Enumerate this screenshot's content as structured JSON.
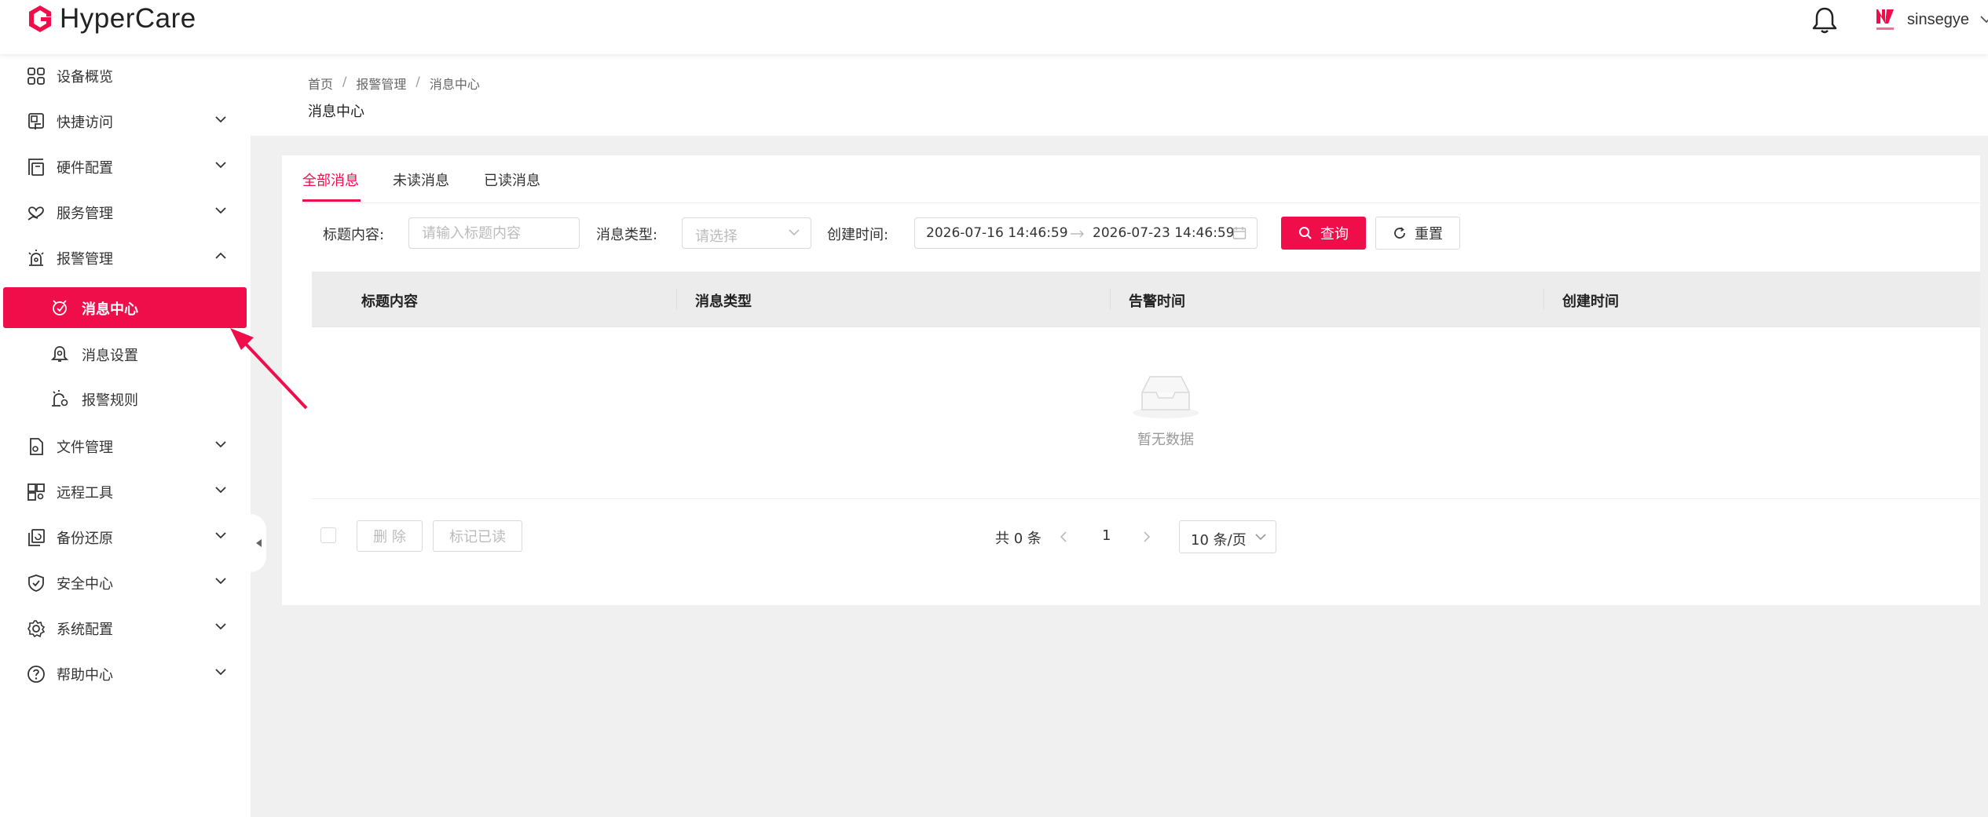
{
  "header": {
    "app_name": "HyperCare",
    "user_name": "sinsegye",
    "colors": {
      "brand": "#ef0e4a"
    }
  },
  "sidebar": {
    "items": [
      {
        "label": "设备概览",
        "icon": "grid-icon"
      },
      {
        "label": "快捷访问",
        "icon": "quick-access-icon"
      },
      {
        "label": "硬件配置",
        "icon": "hardware-icon"
      },
      {
        "label": "服务管理",
        "icon": "service-heart-icon"
      },
      {
        "label": "报警管理",
        "icon": "alarm-icon"
      },
      {
        "label": "文件管理",
        "icon": "file-gear-icon"
      },
      {
        "label": "远程工具",
        "icon": "remote-tool-icon"
      },
      {
        "label": "备份还原",
        "icon": "backup-icon"
      },
      {
        "label": "安全中心",
        "icon": "shield-icon"
      },
      {
        "label": "系统配置",
        "icon": "system-gear-icon"
      },
      {
        "label": "帮助中心",
        "icon": "help-icon"
      }
    ],
    "alarm_sub": [
      {
        "label": "消息中心",
        "icon": "message-center-icon"
      },
      {
        "label": "消息设置",
        "icon": "bell-settings-icon"
      },
      {
        "label": "报警规则",
        "icon": "alarm-rule-icon"
      }
    ]
  },
  "breadcrumb": [
    "首页",
    "报警管理",
    "消息中心"
  ],
  "page_title": "消息中心",
  "tabs": [
    "全部消息",
    "未读消息",
    "已读消息"
  ],
  "filters": {
    "title_label": "标题内容:",
    "title_placeholder": "请输入标题内容",
    "type_label": "消息类型:",
    "type_placeholder": "请选择",
    "time_label": "创建时间:",
    "start_time": "2026-07-16 14:46:59",
    "end_time": "2026-07-23 14:46:59",
    "search_label": "查询",
    "reset_label": "重置"
  },
  "table": {
    "columns": [
      "标题内容",
      "消息类型",
      "告警时间",
      "创建时间"
    ],
    "empty_text": "暂无数据"
  },
  "footer": {
    "delete_label": "删 除",
    "mark_read_label": "标记已读",
    "total_text": "共 0 条",
    "current_page": "1",
    "page_size": "10 条/页"
  }
}
